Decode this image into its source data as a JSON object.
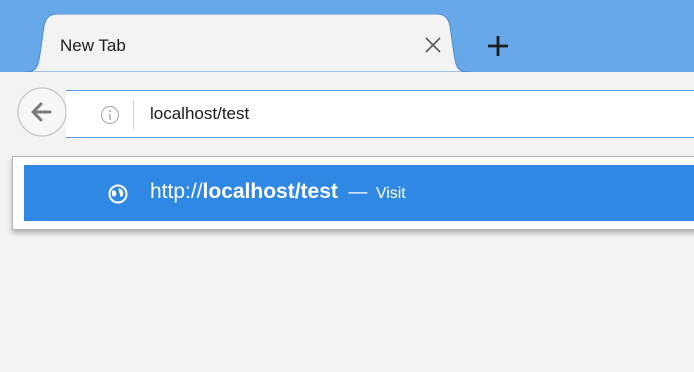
{
  "tab": {
    "title": "New Tab",
    "close_icon": "close-icon",
    "new_tab_icon": "plus-icon"
  },
  "navbar": {
    "back_icon": "back-arrow-icon",
    "info_icon": "info-icon",
    "url": "localhost/test"
  },
  "dropdown": {
    "suggestion": {
      "icon": "globe-icon",
      "prefix": "http://",
      "host": "localhost/test",
      "dash": "—",
      "action": "Visit"
    }
  },
  "colors": {
    "tabstrip": "#66a8e8",
    "accent": "#2f88e3",
    "url_border": "#5a9ee6",
    "background": "#f3f3f3"
  }
}
